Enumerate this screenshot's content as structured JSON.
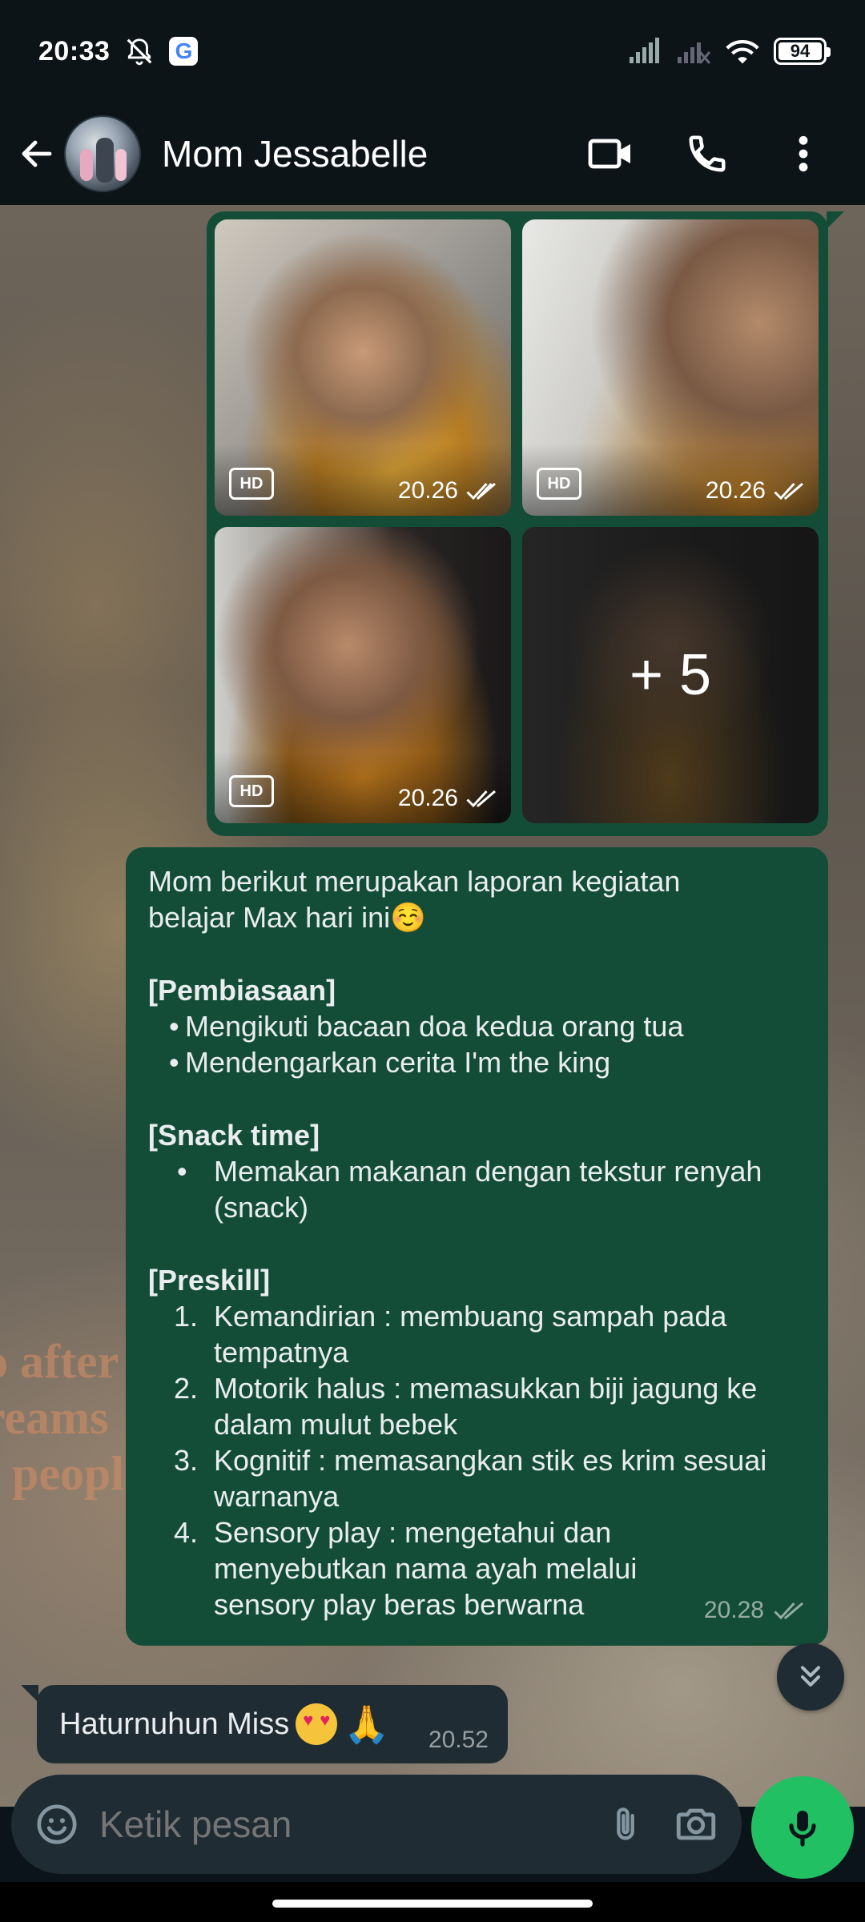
{
  "status_bar": {
    "time": "20:33",
    "battery": "94",
    "google_badge": "G"
  },
  "header": {
    "contact_name": "Mom Jessabelle"
  },
  "album": {
    "items": [
      {
        "time": "20.26",
        "hd": "HD"
      },
      {
        "time": "20.26",
        "hd": "HD"
      },
      {
        "time": "20.26",
        "hd": "HD"
      },
      {
        "more": "+ 5"
      }
    ]
  },
  "report_message": {
    "intro_line1": "Mom berikut merupakan laporan kegiatan",
    "intro_line2": "belajar Max hari ini☺️",
    "section1_title": "[Pembiasaan]",
    "section1_items": [
      "Mengikuti bacaan doa kedua orang tua",
      "Mendengarkan cerita I'm the king"
    ],
    "section2_title": "[Snack time]",
    "section2_items": [
      "Memakan makanan dengan tekstur renyah (snack)"
    ],
    "section3_title": "[Preskill]",
    "section3_items": [
      "Kemandirian : membuang sampah pada tempatnya",
      "Motorik halus : memasukkan biji jagung ke dalam mulut bebek",
      "Kognitif : memasangkan stik es krim sesuai warnanya",
      "Sensory play : mengetahui dan menyebutkan nama ayah melalui sensory play beras berwarna"
    ],
    "bullet": "•",
    "time": "20.28"
  },
  "reply_message": {
    "text": "Haturnuhun Miss",
    "emoji_pray": "🙏",
    "time": "20.52"
  },
  "composer": {
    "placeholder": "Ketik pesan"
  },
  "colors": {
    "outgoing_bubble": "#144d37",
    "incoming_bubble": "#1f2c34",
    "mic_button": "#21c063",
    "bar_background": "#0d1418"
  }
}
